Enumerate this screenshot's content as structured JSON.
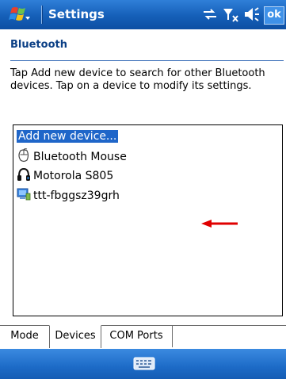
{
  "window": {
    "title": "Settings",
    "ok_label": "ok",
    "start_icon": "windows-flag-icon",
    "status_icons": [
      "connectivity-icon",
      "no-signal-icon",
      "speaker-icon"
    ]
  },
  "page": {
    "header": "Bluetooth",
    "instructions": "Tap Add new device to search for other Bluetooth devices. Tap on a device to modify its settings."
  },
  "devices": [
    {
      "label": "Add new device...",
      "icon": "",
      "selected": true
    },
    {
      "label": "Bluetooth Mouse",
      "icon": "mouse-icon",
      "selected": false
    },
    {
      "label": "Motorola S805",
      "icon": "headphones-icon",
      "selected": false
    },
    {
      "label": "ttt-fbggsz39grh",
      "icon": "computer-icon",
      "selected": false
    }
  ],
  "tabs": [
    {
      "label": "Mode",
      "active": false
    },
    {
      "label": "Devices",
      "active": true
    },
    {
      "label": "COM Ports",
      "active": false
    }
  ],
  "menubar": {
    "icon": "keyboard-icon"
  },
  "colors": {
    "titlebar": "#155fb8",
    "selection": "#1f66c9",
    "header_text": "#0b3f85",
    "annotation_arrow": "#e00000"
  }
}
